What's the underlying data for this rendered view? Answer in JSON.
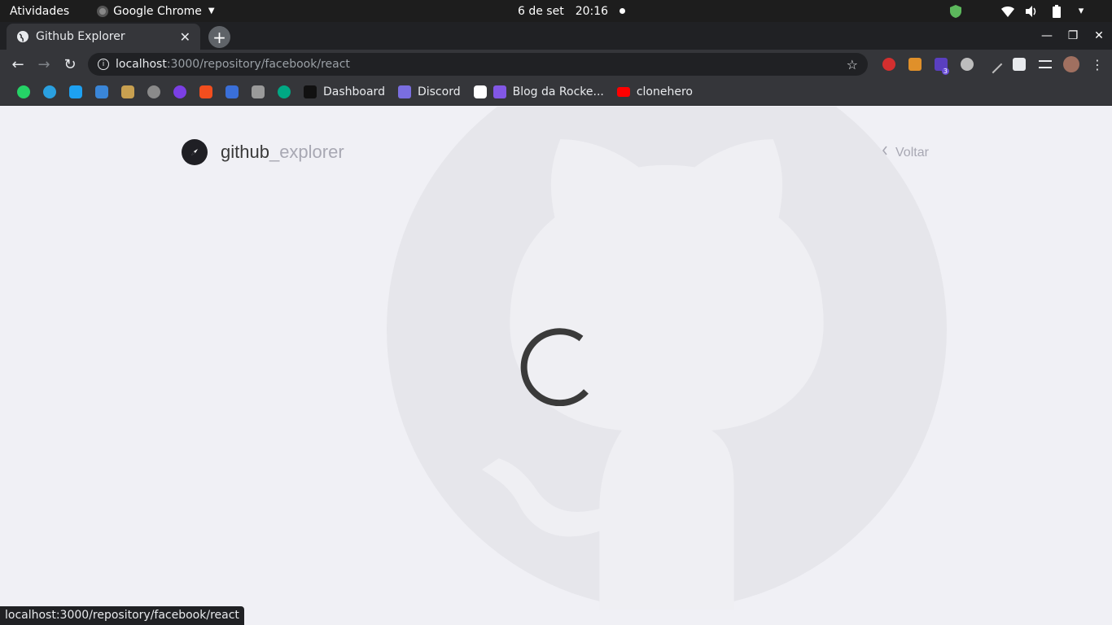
{
  "os_bar": {
    "activities": "Atividades",
    "app_name": "Google Chrome",
    "date": "6 de set",
    "time": "20:16"
  },
  "browser": {
    "tab_title": "Github Explorer",
    "url_host": "localhost",
    "url_path": ":3000/repository/facebook/react",
    "extension_badge": "3",
    "bookmarks": [
      {
        "label": "Dashboard"
      },
      {
        "label": "Discord"
      },
      {
        "label": "Blog da Rocke..."
      },
      {
        "label": "clonehero"
      }
    ],
    "status_url": "localhost:3000/repository/facebook/react"
  },
  "page": {
    "brand_main": "github",
    "brand_accent": "_explorer",
    "back_label": "Voltar"
  },
  "colors": {
    "page_bg": "#f0f0f5",
    "brand_text": "#3a3a3a",
    "brand_accent": "#a8a8b3",
    "spinner": "#3a3a3a"
  }
}
